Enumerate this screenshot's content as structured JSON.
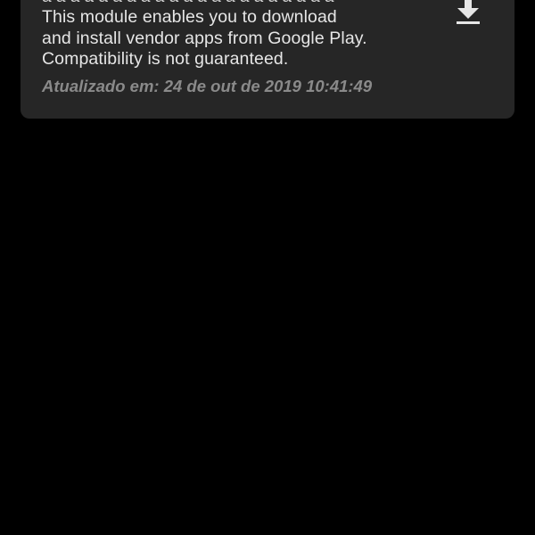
{
  "module": {
    "description": "This module enables you to download\nand install vendor apps from Google Play.\nCompatibility is not guaranteed.",
    "updated": "Atualizado em: 24 de out de 2019 10:41:49",
    "download_icon": "download-icon"
  },
  "colors": {
    "background": "#000000",
    "card": "#262626",
    "text": "#e6e6e6",
    "updated_text": "#8a8a8a",
    "icon": "#e6e6e6"
  }
}
